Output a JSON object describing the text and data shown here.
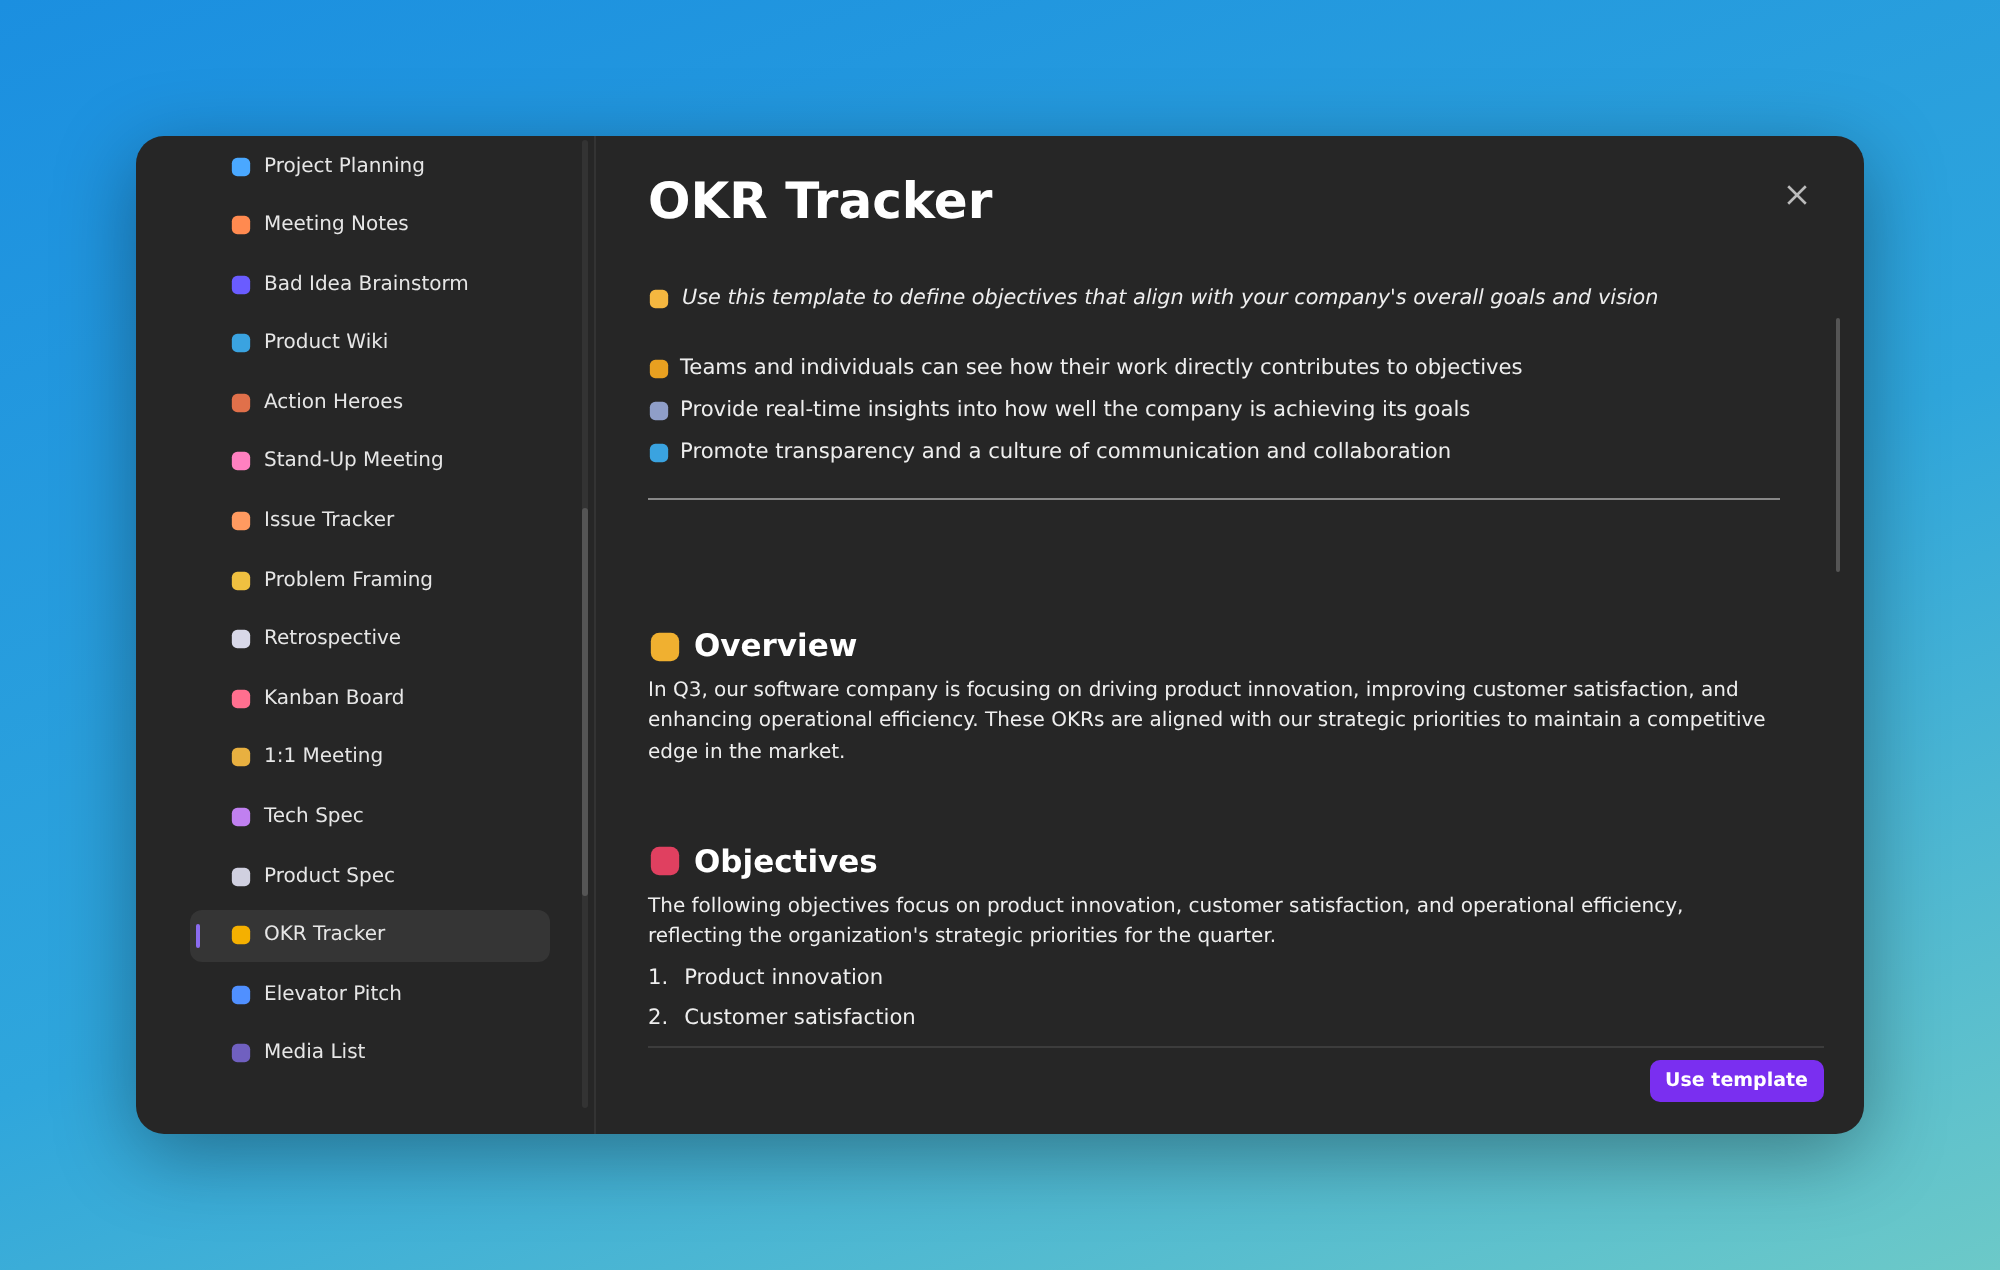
{
  "sidebar": {
    "items": [
      {
        "label": "Project Planning",
        "selected": false
      },
      {
        "label": "Meeting Notes",
        "selected": false
      },
      {
        "label": "Bad Idea Brainstorm",
        "selected": false
      },
      {
        "label": "Product Wiki",
        "selected": false
      },
      {
        "label": "Action Heroes",
        "selected": false
      },
      {
        "label": "Stand-Up Meeting",
        "selected": false
      },
      {
        "label": "Issue Tracker",
        "selected": false
      },
      {
        "label": "Problem Framing",
        "selected": false
      },
      {
        "label": "Retrospective",
        "selected": false
      },
      {
        "label": "Kanban Board",
        "selected": false
      },
      {
        "label": "1:1 Meeting",
        "selected": false
      },
      {
        "label": "Tech Spec",
        "selected": false
      },
      {
        "label": "Product Spec",
        "selected": false
      },
      {
        "label": "OKR Tracker",
        "selected": true
      },
      {
        "label": "Elevator Pitch",
        "selected": false
      },
      {
        "label": "Media List",
        "selected": false
      }
    ]
  },
  "title": "OKR Tracker",
  "intro": "Use this template to define objectives that align with your company's overall goals and vision",
  "benefits": [
    "Teams and individuals can see how their work directly contributes to objectives",
    "Provide real-time insights into how well the company is achieving its goals",
    "Promote transparency and a culture of communication and collaboration"
  ],
  "sections": [
    {
      "heading": "Overview",
      "text": "In Q3, our software company is focusing on driving product innovation, improving customer satisfaction, and enhancing operational efficiency. These OKRs are aligned with our strategic priorities to maintain a competitive edge in the market."
    },
    {
      "heading": "Objectives",
      "text": "The following objectives focus on product innovation, customer satisfaction, and operational efficiency, reflecting the organization's strategic priorities for the quarter.",
      "list": [
        {
          "number": "1.",
          "text": "Product innovation"
        },
        {
          "number": "2.",
          "text": "Customer satisfaction"
        }
      ]
    }
  ],
  "footer": {
    "button": "Use template"
  }
}
